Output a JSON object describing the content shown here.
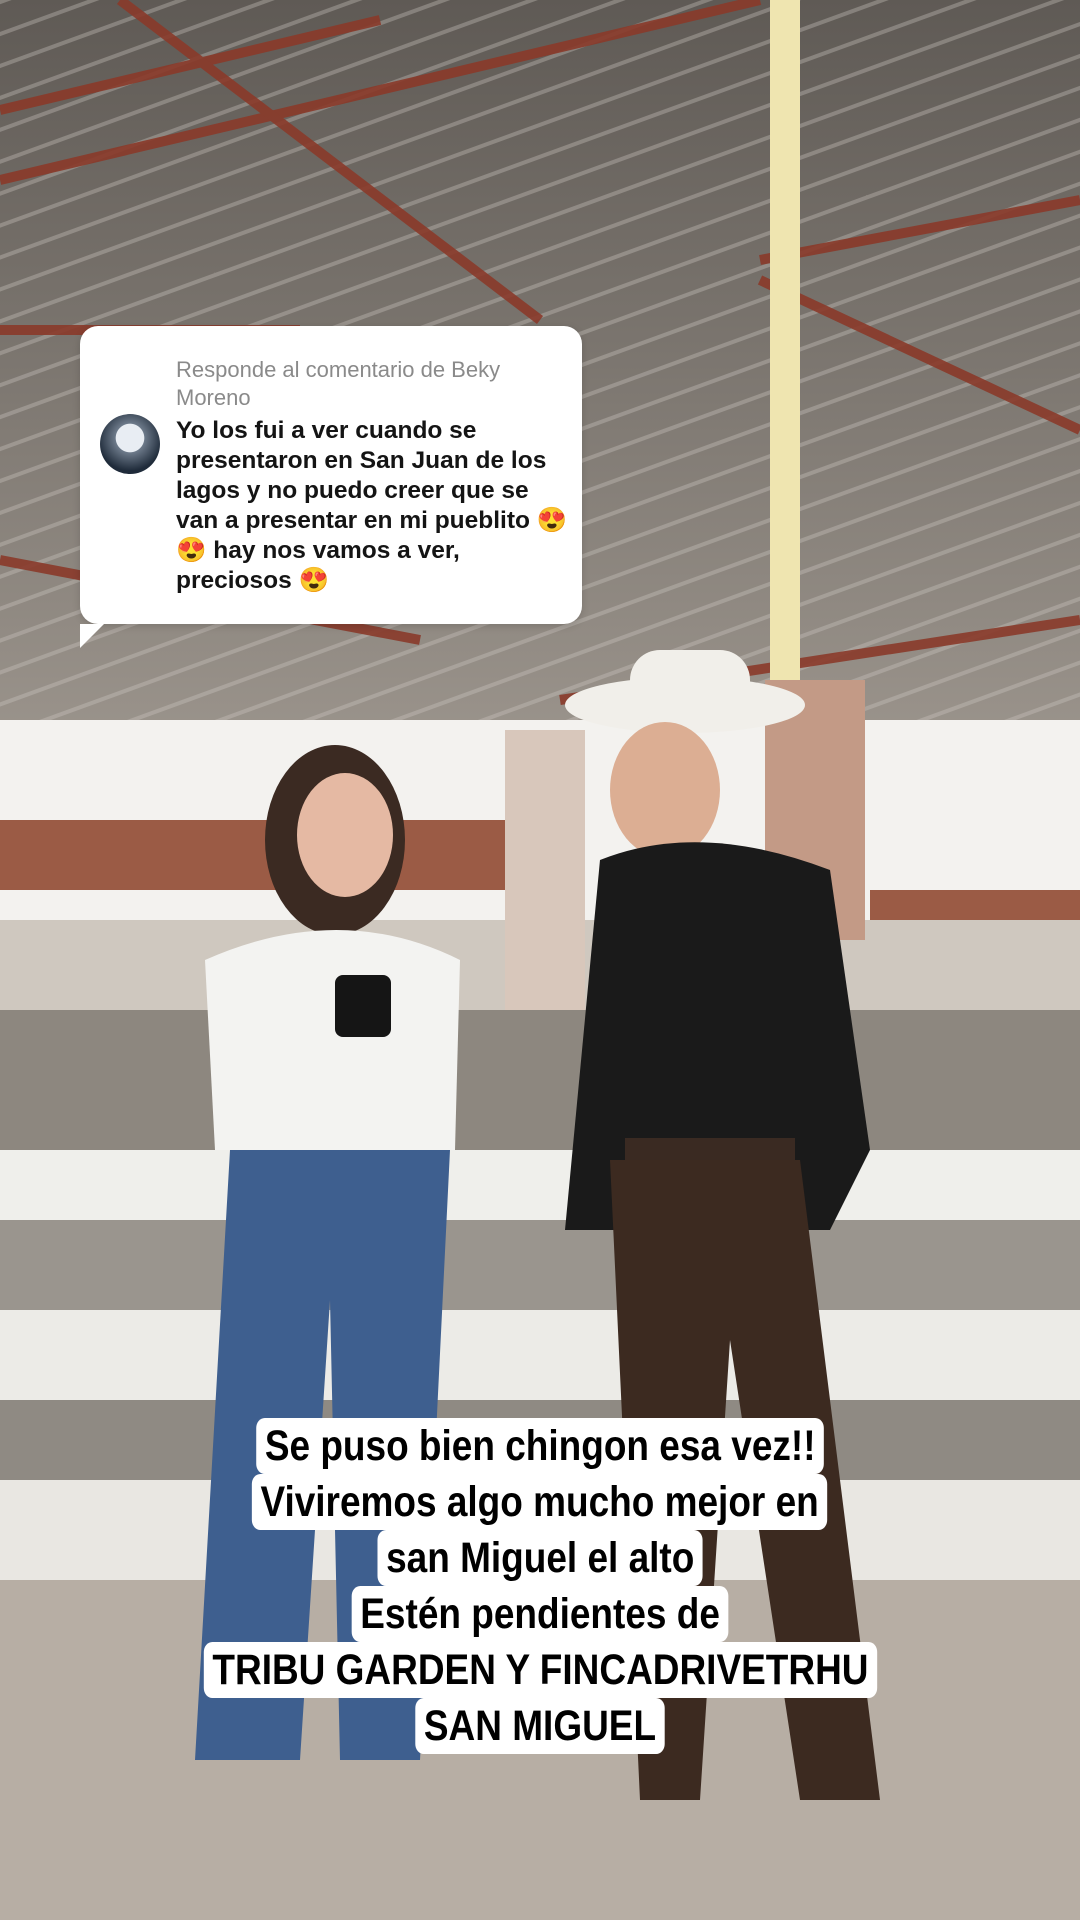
{
  "comment": {
    "header": "Responde al comentario de Beky Moreno",
    "text": "Yo los fui a ver cuando se presentaron en San Juan de los lagos y no puedo creer que se van a presentar en mi pueblito 😍😍 hay nos vamos a ver, preciosos 😍"
  },
  "caption": {
    "lines": [
      "Se puso bien chingon esa vez!!",
      "Viviremos algo mucho mejor en",
      "san Miguel el alto",
      "Estén pendientes de",
      "TRIBU GARDEN Y FINCADRIVETRHU",
      "SAN MIGUEL"
    ]
  }
}
